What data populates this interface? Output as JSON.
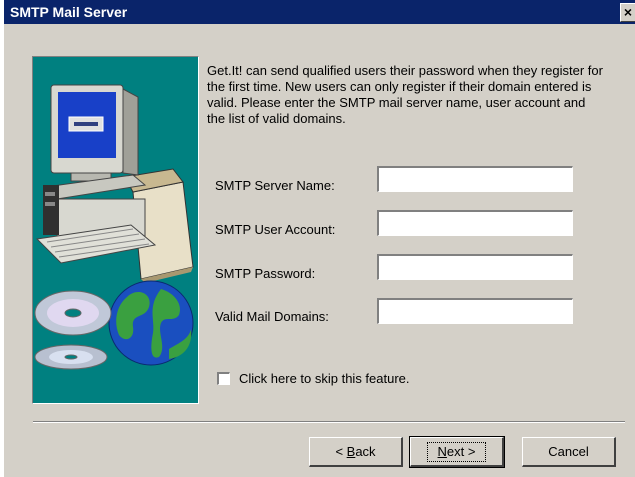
{
  "window": {
    "title": "SMTP Mail Server",
    "close_glyph": "×"
  },
  "description": "Get.It! can send qualified users their password when they register for the first time.  New users can only register if their domain entered is valid.  Please enter the SMTP mail server name, user account and the list of valid domains.",
  "fields": [
    {
      "label": "SMTP Server Name:",
      "value": ""
    },
    {
      "label": "SMTP User Account:",
      "value": ""
    },
    {
      "label": "SMTP Password:",
      "value": ""
    },
    {
      "label": "Valid Mail Domains:",
      "value": ""
    }
  ],
  "skip_checkbox": {
    "label": "Click here to skip this feature.",
    "checked": false
  },
  "buttons": {
    "back": {
      "accel": "B",
      "rest": "ack",
      "prefix": "< "
    },
    "next": {
      "accel": "N",
      "rest": "ext >"
    },
    "cancel": "Cancel"
  },
  "colors": {
    "titlebar": "#0a246a",
    "dialog": "#d4d0c8",
    "art_panel": "#008080"
  },
  "icons": [
    "close-icon",
    "computer-illustration",
    "globe-icon",
    "cd-disc-icon"
  ]
}
